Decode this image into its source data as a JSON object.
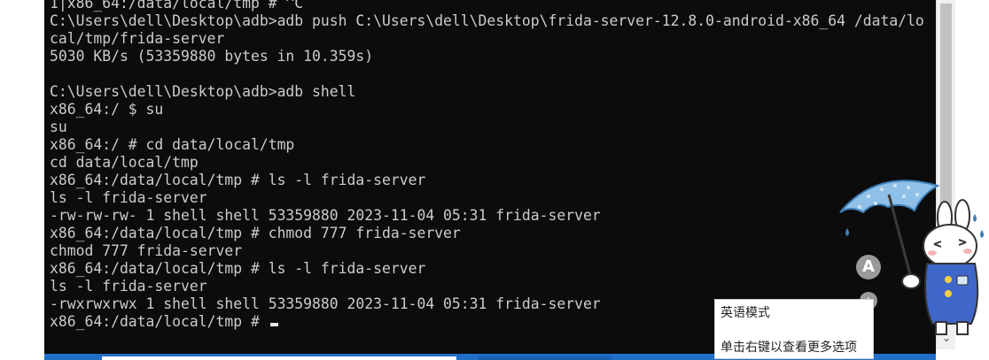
{
  "terminal": {
    "lines": [
      "1|x86_64:/data/local/tmp # ^C",
      "C:\\Users\\dell\\Desktop\\adb>adb push C:\\Users\\dell\\Desktop\\frida-server-12.8.0-android-x86_64 /data/lo",
      "cal/tmp/frida-server",
      "5030 KB/s (53359880 bytes in 10.359s)",
      "",
      "C:\\Users\\dell\\Desktop\\adb>adb shell",
      "x86_64:/ $ su",
      "su",
      "x86_64:/ # cd data/local/tmp",
      "cd data/local/tmp",
      "x86_64:/data/local/tmp # ls -l frida-server",
      "ls -l frida-server",
      "-rw-rw-rw- 1 shell shell 53359880 2023-11-04 05:31 frida-server",
      "x86_64:/data/local/tmp # chmod 777 frida-server",
      "chmod 777 frida-server",
      "x86_64:/data/local/tmp # ls -l frida-server",
      "ls -l frida-server",
      "-rwxrwxrwx 1 shell shell 53359880 2023-11-04 05:31 frida-server",
      "x86_64:/data/local/tmp # "
    ],
    "background": "#0c0c0c",
    "foreground": "#cccccc"
  },
  "ime_tooltip": {
    "mode": "英语模式",
    "hint": "单击右键以查看更多选项"
  },
  "ime_toolbar": {
    "mode_button": "A",
    "mascot": "rabbit-with-umbrella",
    "skin_icon": "shirt-icon"
  },
  "taskbar": {
    "accent": "#1f6fc9"
  }
}
